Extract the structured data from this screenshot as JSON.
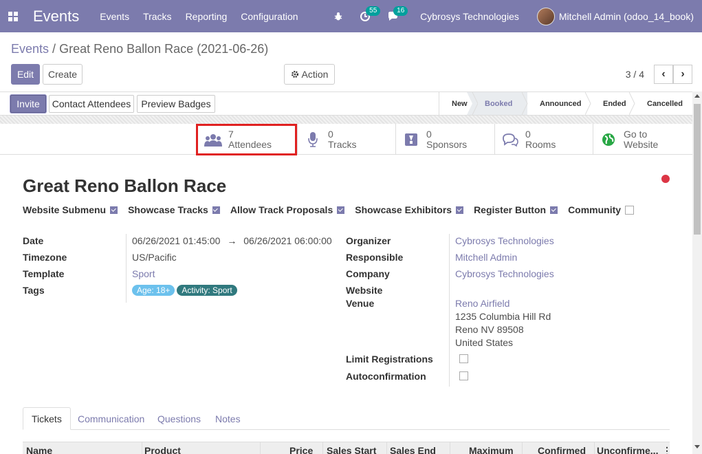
{
  "navbar": {
    "app_name": "Events",
    "menu": [
      "Events",
      "Tracks",
      "Reporting",
      "Configuration"
    ],
    "activity_count": "55",
    "message_count": "16",
    "company": "Cybrosys Technologies",
    "user": "Mitchell Admin (odoo_14_book)"
  },
  "breadcrumb": {
    "parent": "Events",
    "separator": "/",
    "current": "Great Reno Ballon Race (2021-06-26)"
  },
  "toolbar": {
    "edit": "Edit",
    "create": "Create",
    "action": "Action",
    "pager": "3 / 4"
  },
  "statusbar": {
    "buttons": [
      "Invite",
      "Contact Attendees",
      "Preview Badges"
    ],
    "stages": [
      "New",
      "Booked",
      "Announced",
      "Ended",
      "Cancelled"
    ],
    "active_stage": "Booked"
  },
  "smart_buttons": [
    {
      "count": "7",
      "label": "Attendees",
      "icon": "users-icon"
    },
    {
      "count": "0",
      "label": "Tracks",
      "icon": "microphone-icon"
    },
    {
      "count": "0",
      "label": "Sponsors",
      "icon": "badge-icon"
    },
    {
      "count": "0",
      "label": "Rooms",
      "icon": "chat-icon"
    },
    {
      "count": "Go to",
      "label": "Website",
      "icon": "globe-icon"
    }
  ],
  "form": {
    "title": "Great Reno Ballon Race",
    "flags": [
      {
        "label": "Website Submenu",
        "checked": true
      },
      {
        "label": "Showcase Tracks",
        "checked": true
      },
      {
        "label": "Allow Track Proposals",
        "checked": true
      },
      {
        "label": "Showcase Exhibitors",
        "checked": true
      },
      {
        "label": "Register Button",
        "checked": true
      },
      {
        "label": "Community",
        "checked": false
      }
    ],
    "left": {
      "date_label": "Date",
      "date_start": "06/26/2021 01:45:00",
      "date_arrow": "→",
      "date_end": "06/26/2021 06:00:00",
      "timezone_label": "Timezone",
      "timezone": "US/Pacific",
      "template_label": "Template",
      "template": "Sport",
      "tags_label": "Tags",
      "tags": [
        {
          "name": "Age: 18+",
          "color": "#6cc1ed"
        },
        {
          "name": "Activity: Sport",
          "color": "#30797e"
        }
      ]
    },
    "right": {
      "organizer_label": "Organizer",
      "organizer": "Cybrosys Technologies",
      "responsible_label": "Responsible",
      "responsible": "Mitchell Admin",
      "company_label": "Company",
      "company": "Cybrosys Technologies",
      "website_label": "Website",
      "venue_label": "Venue",
      "venue_name": "Reno Airfield",
      "venue_street": "1235 Columbia Hill Rd",
      "venue_city": "Reno NV 89508",
      "venue_country": "United States",
      "limit_label": "Limit Registrations",
      "autoconfirm_label": "Autoconfirmation"
    }
  },
  "notebook": {
    "tabs": [
      "Tickets",
      "Communication",
      "Questions",
      "Notes"
    ],
    "columns": [
      "Name",
      "Product",
      "Price",
      "Sales Start",
      "Sales End",
      "Maximum",
      "Confirmed",
      "Unconfirme..."
    ]
  },
  "colors": {
    "brand": "#7c7bad",
    "highlight": "#e02020",
    "status_red": "#dc3545"
  }
}
